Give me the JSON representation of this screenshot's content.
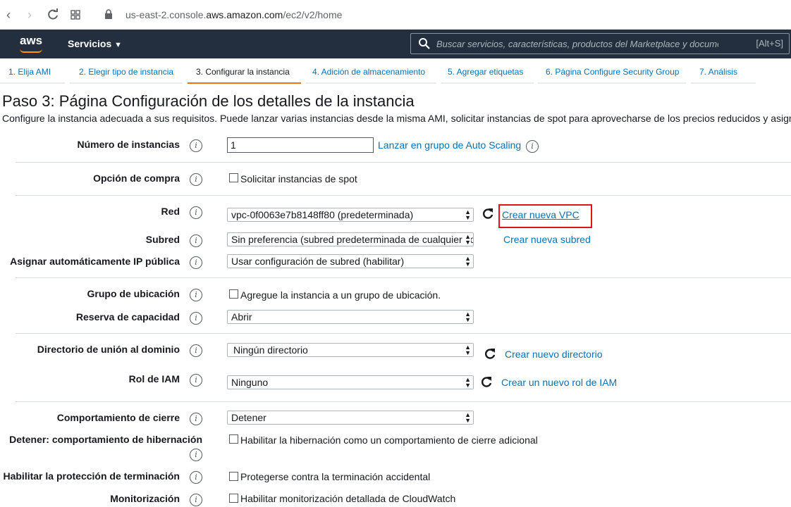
{
  "browser": {
    "url_prefix": "us-east-2.console.",
    "url_domain": "aws.amazon.com",
    "url_path": "/ec2/v2/home"
  },
  "header": {
    "logo": "aws",
    "services_label": "Servicios",
    "search_placeholder": "Buscar servicios, características, productos del Marketplace y documentos",
    "search_shortcut": "[Alt+S]"
  },
  "tabs": [
    {
      "label": "1. Elija AMI"
    },
    {
      "label": "2. Elegir tipo de instancia"
    },
    {
      "label": "3. Configurar la instancia"
    },
    {
      "label": "4. Adición de almacenamiento"
    },
    {
      "label": "5. Agregar etiquetas"
    },
    {
      "label": "6. Página Configure Security Group"
    },
    {
      "label": "7. Análisis"
    }
  ],
  "page": {
    "title": "Paso 3: Página Configuración de los detalles de la instancia",
    "description": "Configure la instancia adecuada a sus requisitos. Puede lanzar varias instancias desde la misma AMI, solicitar instancias de spot para aprovecharse de los precios reducidos y asignar un rol de administración de acceso a la instancia, etc."
  },
  "form": {
    "instances": {
      "label": "Número de instancias",
      "value": "1",
      "link": "Lanzar en grupo de Auto Scaling"
    },
    "purchase": {
      "label": "Opción de compra",
      "checkbox": "Solicitar instancias de spot"
    },
    "network": {
      "label": "Red",
      "value": "vpc-0f0063e7b8148ff80 (predeterminada)",
      "link": "Crear nueva VPC"
    },
    "subnet": {
      "label": "Subred",
      "value": "Sin preferencia (subred predeterminada de cualquier zona de disponibilidad)",
      "link": "Crear nueva subred"
    },
    "public_ip": {
      "label": "Asignar automáticamente IP pública",
      "value": "Usar configuración de subred (habilitar)"
    },
    "placement": {
      "label": "Grupo de ubicación",
      "checkbox": "Agregue la instancia a un grupo de ubicación."
    },
    "capacity": {
      "label": "Reserva de capacidad",
      "value": "Abrir"
    },
    "domain": {
      "label": "Directorio de unión al dominio",
      "value": "Ningún directorio",
      "link": "Crear nuevo directorio"
    },
    "iam": {
      "label": "Rol de IAM",
      "value": "Ninguno",
      "link": "Crear un nuevo rol de IAM"
    },
    "shutdown": {
      "label": "Comportamiento de cierre",
      "value": "Detener"
    },
    "hibernate": {
      "label": "Detener: comportamiento de hibernación",
      "checkbox": "Habilitar la hibernación como un comportamiento de cierre adicional"
    },
    "termination": {
      "label": "Habilitar la protección de terminación",
      "checkbox": "Protegerse contra la terminación accidental"
    },
    "monitoring": {
      "label": "Monitorización",
      "checkbox": "Habilitar monitorización detallada de CloudWatch"
    }
  },
  "info_glyph": "i",
  "colors": {
    "header_bg": "#232f3e",
    "accent": "#ec7211",
    "link": "#0073bb",
    "highlight": "#e0131c"
  }
}
